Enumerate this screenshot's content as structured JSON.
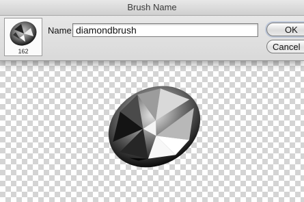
{
  "dialog": {
    "title": "Brush Name",
    "preview_size": "162",
    "name_label": "Name:",
    "name_value": "diamondbrush",
    "ok_label": "OK",
    "cancel_label": "Cancel"
  },
  "icons": {
    "preview": "brush-preview-icon",
    "canvas": "diamond-brush-image"
  }
}
